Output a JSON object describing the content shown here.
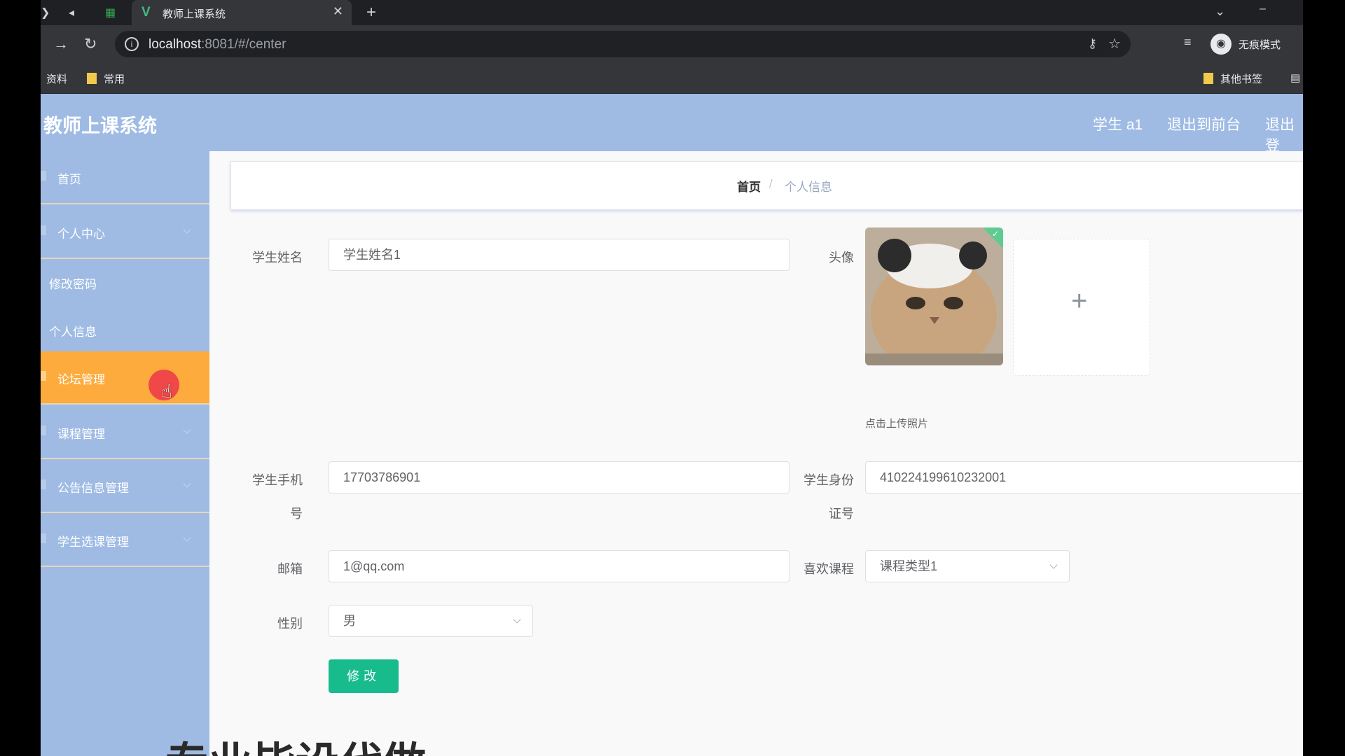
{
  "browser": {
    "tab_title": "教师上课系统",
    "tab_icon": "vue-logo-icon",
    "url_host": "localhost",
    "url_rest": ":8081/#/center",
    "incognito_label": "无痕模式",
    "bookmarks": [
      "资料",
      "常用"
    ],
    "other_bookmarks": "其他书签"
  },
  "app": {
    "title": "教师上课系统",
    "user": "学生 a1",
    "exit_front": "退出到前台",
    "exit": "退出登"
  },
  "sidebar": {
    "items": [
      {
        "label": "首页"
      },
      {
        "label": "个人中心"
      },
      {
        "label": "修改密码"
      },
      {
        "label": "个人信息"
      },
      {
        "label": "论坛管理"
      },
      {
        "label": "课程管理"
      },
      {
        "label": "公告信息管理"
      },
      {
        "label": "学生选课管理"
      }
    ]
  },
  "breadcrumb": {
    "home": "首页",
    "sep": "/",
    "current": "个人信息"
  },
  "form": {
    "name_label": "学生姓名",
    "name_value": "学生姓名1",
    "avatar_label": "头像",
    "upload_hint": "点击上传照片",
    "phone_label_1": "学生手机",
    "phone_label_2": "号",
    "phone_value": "17703786901",
    "id_label_1": "学生身份",
    "id_label_2": "证号",
    "id_value": "410224199610232001",
    "email_label": "邮箱",
    "email_value": "1@qq.com",
    "course_label": "喜欢课程",
    "course_value": "课程类型1",
    "gender_label": "性别",
    "gender_value": "男",
    "submit": "修改"
  },
  "caption": "专业毕设代做",
  "colors": {
    "header": "#9fbbe4",
    "active": "#fdab3c",
    "button": "#18bc8c"
  }
}
